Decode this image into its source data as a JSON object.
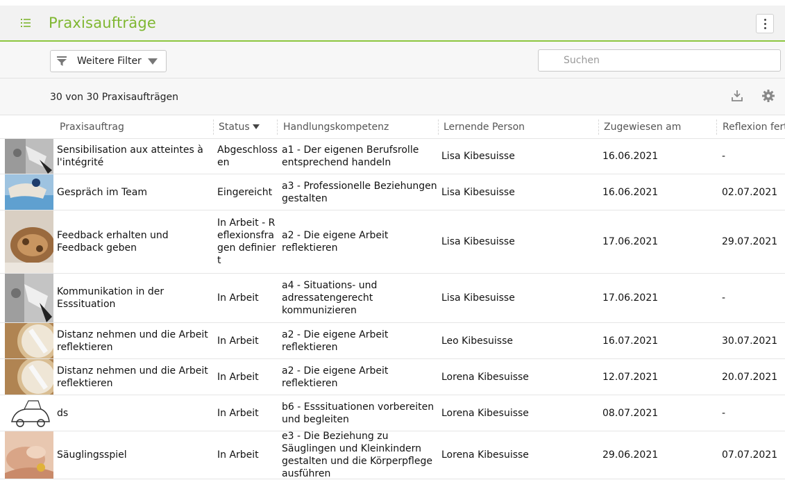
{
  "header": {
    "title": "Praxisaufträge"
  },
  "toolbar": {
    "filter_label": "Weitere Filter",
    "search_placeholder": "Suchen"
  },
  "summary": {
    "count_text": "30 von 30 Praxisaufträgen"
  },
  "table": {
    "columns": [
      "Praxisauftrag",
      "Status",
      "Handlungskompetenz",
      "Lernende Person",
      "Zugewiesen am",
      "Reflexion fert"
    ],
    "rows": [
      {
        "praxisauftrag": "Sensibilisation aux atteintes à l'intégrité",
        "status": "Abgeschlossen",
        "kompetenz": "a1 - Der eigenen Berufsrolle entsprechend handeln",
        "person": "Lisa Kibesuisse",
        "zugewiesen": "16.06.2021",
        "reflexion": "-"
      },
      {
        "praxisauftrag": "Gespräch im Team",
        "status": "Eingereicht",
        "kompetenz": "a3 - Professionelle Beziehungen gestalten",
        "person": "Lisa Kibesuisse",
        "zugewiesen": "16.06.2021",
        "reflexion": "02.07.2021"
      },
      {
        "praxisauftrag": "Feedback erhalten und Feedback geben",
        "status": "In Arbeit - Reflexionsfragen definiert",
        "kompetenz": "a2 - Die eigene Arbeit reflektieren",
        "person": "Lisa Kibesuisse",
        "zugewiesen": "17.06.2021",
        "reflexion": "29.07.2021"
      },
      {
        "praxisauftrag": "Kommunikation in der Esssituation",
        "status": "In Arbeit",
        "kompetenz": "a4 - Situations- und adressatengerecht kommunizieren",
        "person": "Lisa Kibesuisse",
        "zugewiesen": "17.06.2021",
        "reflexion": "-"
      },
      {
        "praxisauftrag": "Distanz nehmen und die Arbeit reflektieren",
        "status": "In Arbeit",
        "kompetenz": "a2 - Die eigene Arbeit reflektieren",
        "person": "Leo Kibesuisse",
        "zugewiesen": "16.07.2021",
        "reflexion": "30.07.2021"
      },
      {
        "praxisauftrag": "Distanz nehmen und die Arbeit reflektieren",
        "status": "In Arbeit",
        "kompetenz": "a2 - Die eigene Arbeit reflektieren",
        "person": "Lorena Kibesuisse",
        "zugewiesen": "12.07.2021",
        "reflexion": "20.07.2021"
      },
      {
        "praxisauftrag": "ds",
        "status": "In Arbeit",
        "kompetenz": "b6 - Esssituationen vorbereiten und begleiten",
        "person": "Lorena Kibesuisse",
        "zugewiesen": "08.07.2021",
        "reflexion": "-"
      },
      {
        "praxisauftrag": "Säuglingsspiel",
        "status": "In Arbeit",
        "kompetenz": "e3 - Die Beziehung zu Säuglingen und Kleinkindern gestalten und die Körperpflege ausführen",
        "person": "Lorena Kibesuisse",
        "zugewiesen": "29.06.2021",
        "reflexion": "07.07.2021"
      }
    ]
  },
  "colors": {
    "accent": "#7fb731",
    "accent_line": "#8dc63f",
    "header_bg": "#f2f2f2"
  }
}
